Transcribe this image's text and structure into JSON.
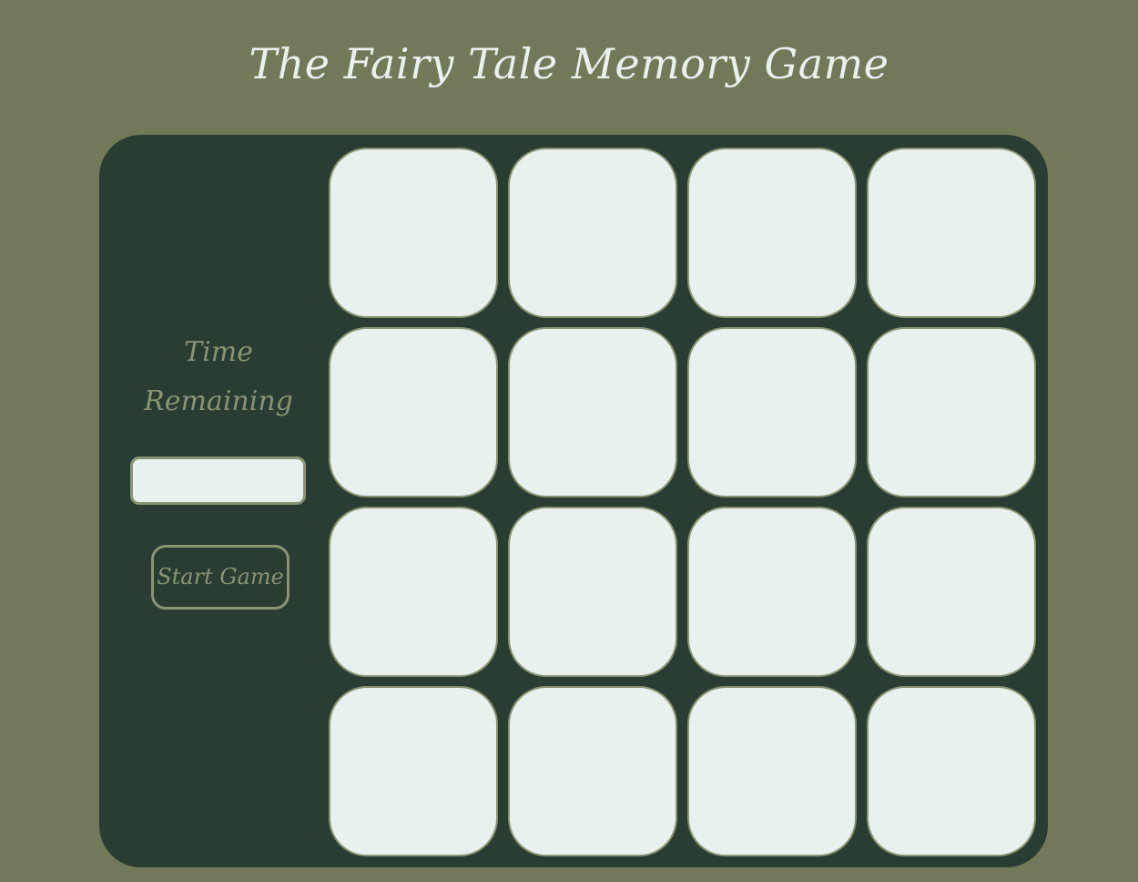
{
  "header": {
    "title": "The Fairy Tale Memory Game"
  },
  "sidebar": {
    "time_label": "Time Remaining",
    "timer_value": "",
    "start_button_label": "Start Game"
  },
  "board": {
    "rows": 4,
    "columns": 4,
    "cards_face_down": 16
  },
  "colors": {
    "page_background": "#717958",
    "panel_background": "#2a3d33",
    "card_face": "#e8f1ee",
    "accent": "#8a9474",
    "title_text": "#e8f1ee"
  }
}
